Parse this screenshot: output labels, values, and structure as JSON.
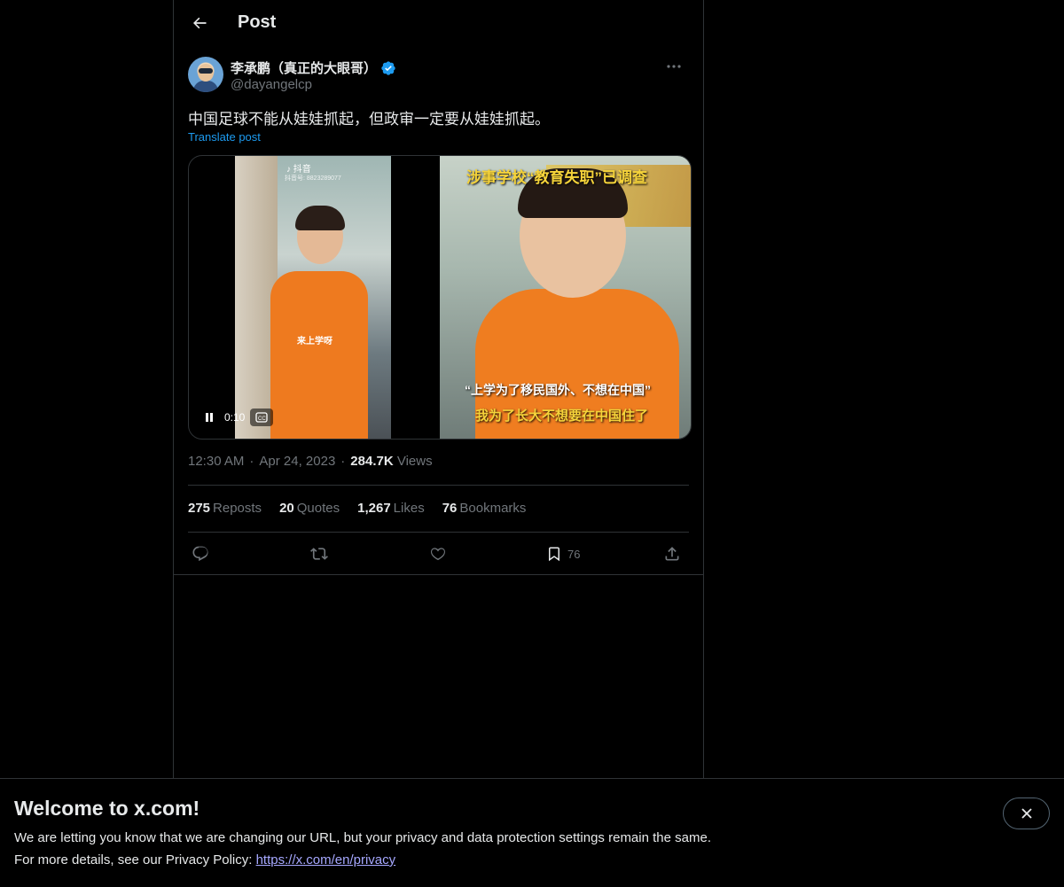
{
  "header": {
    "title": "Post",
    "back_icon": "arrow-left-icon"
  },
  "post": {
    "author": {
      "display_name": "李承鹏（真正的大眼哥）",
      "handle": "@dayangelcp",
      "verified_color": "#1d9bf0"
    },
    "text": "中国足球不能从娃娃抓起，但政审一定要从娃娃抓起。",
    "translate_label": "Translate post",
    "media": {
      "tiktok_label": "抖音",
      "tiktok_id": "抖音号: 8823289077",
      "left_shirt_text": "来上学呀",
      "overlay_top": "涉事学校“教育失职”已调查",
      "caption_line1": "“上学为了移民国外、不想在中国”",
      "caption_line2": "我为了长大不想要在中国住了",
      "time": "0:10"
    },
    "timestamp": {
      "time": "12:30 AM",
      "date": "Apr 24, 2023",
      "views_count": "284.7K",
      "views_label": "Views"
    },
    "stats": {
      "reposts_count": "275",
      "reposts_label": "Reposts",
      "quotes_count": "20",
      "quotes_label": "Quotes",
      "likes_count": "1,267",
      "likes_label": "Likes",
      "bookmarks_count": "76",
      "bookmarks_label": "Bookmarks"
    },
    "actions": {
      "bookmark_count": "76"
    }
  },
  "banner": {
    "title": "Welcome to x.com!",
    "line1": "We are letting you know that we are changing our URL, but your privacy and data protection settings remain the same.",
    "line2_prefix": "For more details, see our Privacy Policy: ",
    "link": "https://x.com/en/privacy"
  },
  "colors": {
    "accent": "#1d9bf0",
    "muted": "#71767b",
    "border": "#2f3336"
  }
}
